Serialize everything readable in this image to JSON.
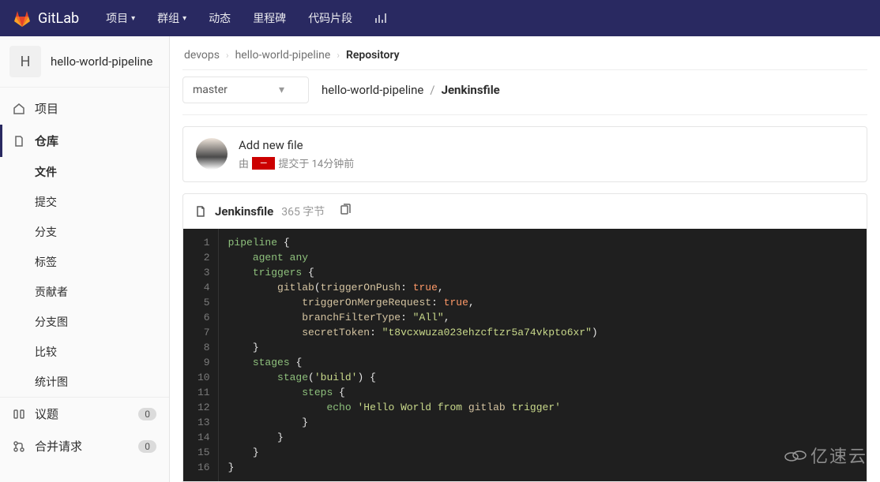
{
  "topnav": {
    "brand": "GitLab",
    "items": [
      "项目",
      "群组",
      "动态",
      "里程碑",
      "代码片段"
    ],
    "caret_indices": [
      0,
      1
    ]
  },
  "project": {
    "avatar_letter": "H",
    "name": "hello-world-pipeline"
  },
  "sidebar": {
    "project_label": "项目",
    "repo_label": "仓库",
    "repo_children": [
      "文件",
      "提交",
      "分支",
      "标签",
      "贡献者",
      "分支图",
      "比较",
      "统计图"
    ],
    "issues_label": "议题",
    "issues_count": "0",
    "mr_label": "合并请求",
    "mr_count": "0"
  },
  "breadcrumb": {
    "items": [
      "devops",
      "hello-world-pipeline",
      "Repository"
    ]
  },
  "branch": "master",
  "path": {
    "root": "hello-world-pipeline",
    "current": "Jenkinsfile"
  },
  "commit": {
    "title": "Add new file",
    "by_prefix": "由",
    "author": "—",
    "meta_suffix": "提交于 14分钟前"
  },
  "file": {
    "name": "Jenkinsfile",
    "size": "365 字节"
  },
  "code": {
    "line_count": 16,
    "token_color_note": "styling only — full content in raw for fidelity",
    "raw": "pipeline {\n    agent any\n    triggers {\n        gitlab(triggerOnPush: true,\n            triggerOnMergeRequest: true,\n            branchFilterType: \"All\",\n            secretToken: \"t8vcxwuza023ehzcftzr5a74vkpto6xr\")\n    }\n    stages {\n        stage('build') {\n            steps {\n                echo 'Hello World from gitlab trigger'\n            }\n        }\n    }\n}"
  },
  "watermark": "亿速云"
}
